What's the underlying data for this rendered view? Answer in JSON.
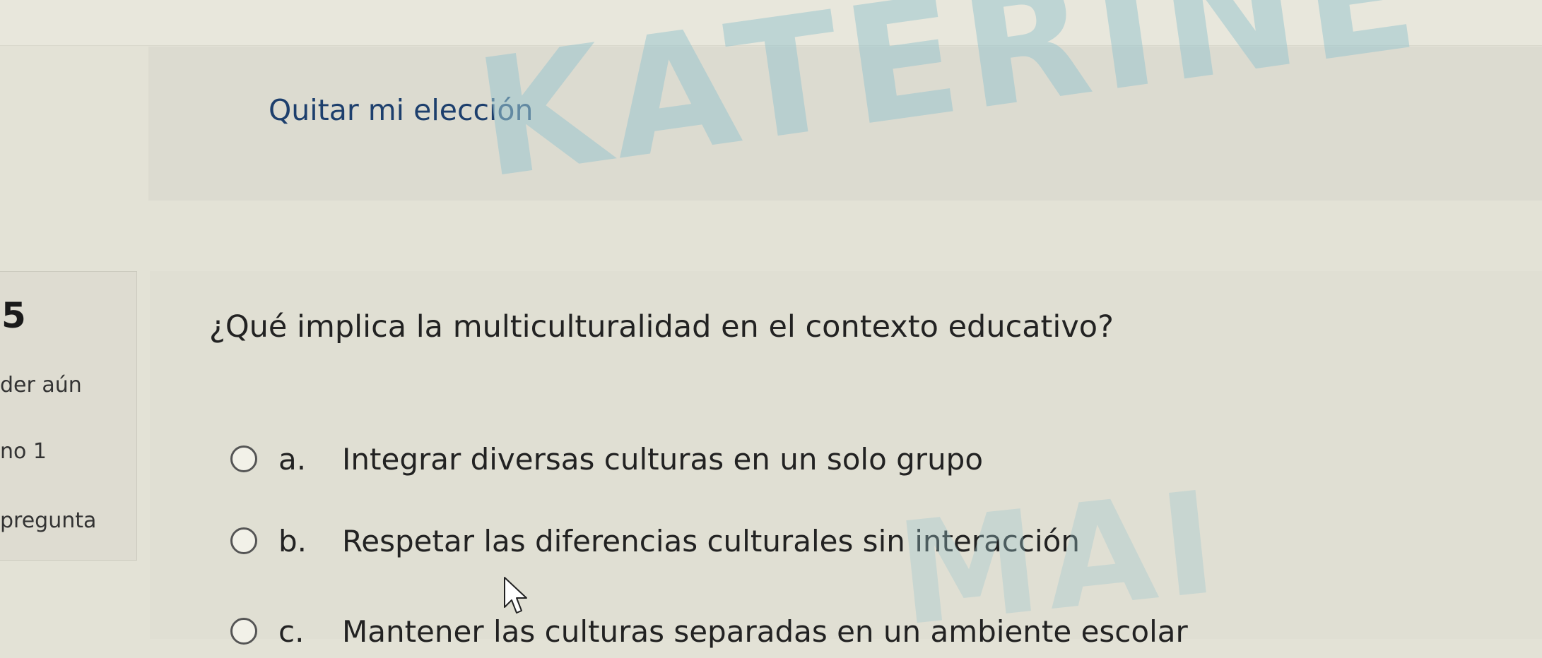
{
  "previous_question": {
    "clear_choice_label": "Quitar mi elección"
  },
  "question_info": {
    "number": "5",
    "state": "der aún",
    "mark": "no 1",
    "flag": "pregunta"
  },
  "question": {
    "text": "¿Qué implica la multiculturalidad en el contexto educativo?",
    "options": [
      {
        "letter": "a.",
        "text": "Integrar diversas culturas en un solo grupo"
      },
      {
        "letter": "b.",
        "text": "Respetar las diferencias culturales sin interacción"
      },
      {
        "letter": "c.",
        "text": "Mantener las culturas separadas en un ambiente escolar"
      }
    ]
  },
  "watermark": {
    "top": "KATERINE",
    "bottom": "MAI"
  },
  "colors": {
    "link": "#1d3f6d",
    "watermark": "#9cc7cf",
    "background": "#e3e2d6"
  }
}
